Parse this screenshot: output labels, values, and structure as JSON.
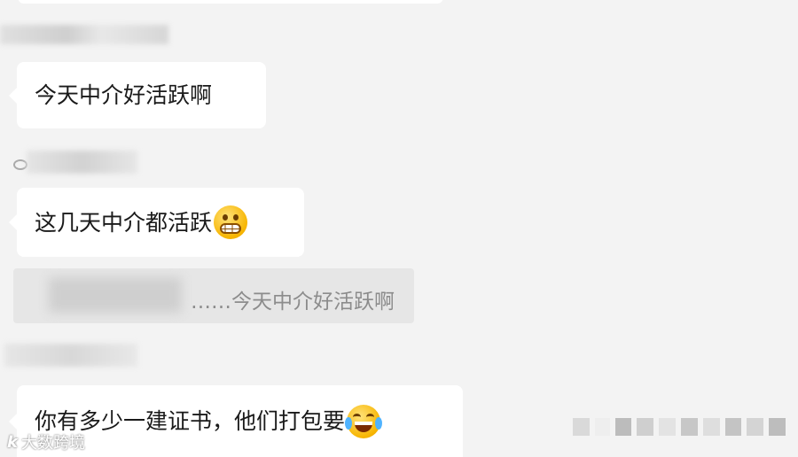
{
  "messages": [
    {
      "text": "今天中介好活跃啊"
    },
    {
      "text": "这几天中介都活跃",
      "emoji": "grinning-face-icon"
    },
    {
      "quote": "……今天中介好活跃啊"
    },
    {
      "text": "你有多少一建证书，他们打包要",
      "emoji": "laughing-tears-icon"
    }
  ],
  "watermark": {
    "logo": "k",
    "text": "大数跨境"
  },
  "colors": {
    "background": "#f3f3f3",
    "bubble": "#ffffff",
    "quote_bg": "#e6e6e6"
  }
}
